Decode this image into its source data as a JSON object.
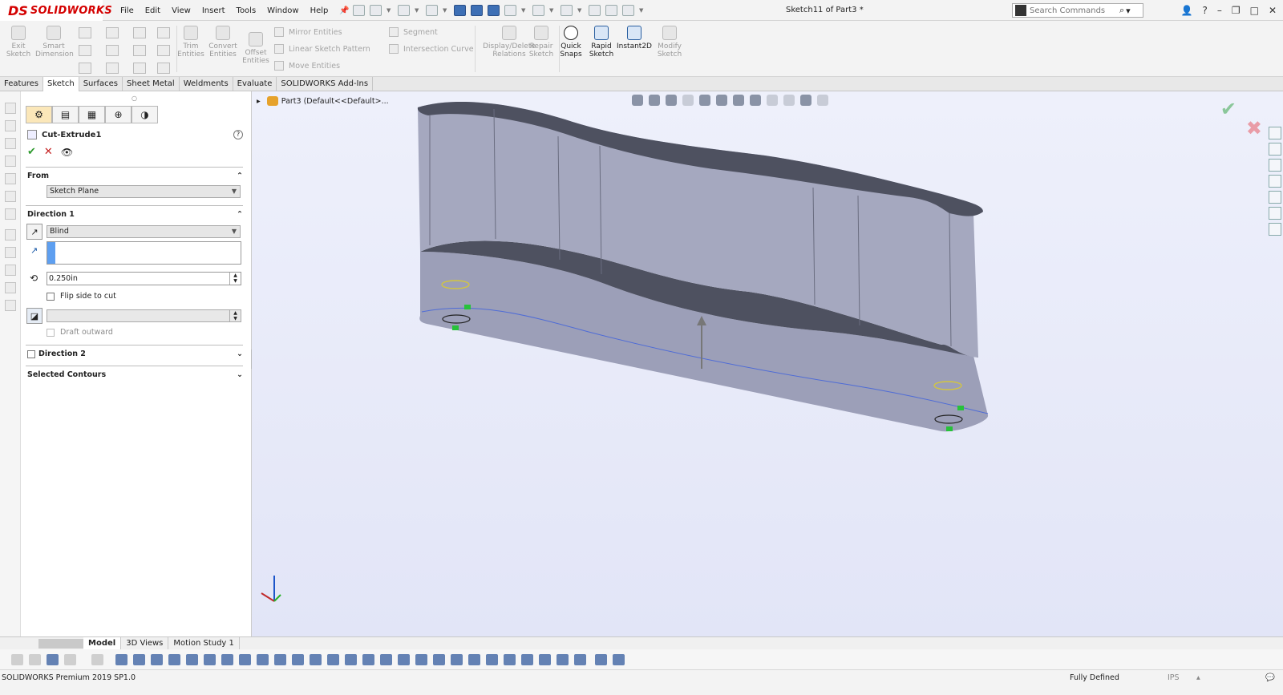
{
  "app": {
    "brand_mark": "DS",
    "brand_name": "SOLIDWORKS",
    "document_title": "Sketch11 of Part3 *",
    "pin_icon": "pushpin-icon"
  },
  "menu": [
    "File",
    "Edit",
    "View",
    "Insert",
    "Tools",
    "Window",
    "Help"
  ],
  "search": {
    "placeholder": "Search Commands"
  },
  "window_controls": {
    "help": "?"
  },
  "ribbon": {
    "exit_sketch": "Exit Sketch",
    "smart_dimension": "Smart Dimension",
    "trim_entities": "Trim Entities",
    "convert_entities": "Convert Entities",
    "offset_entities": "Offset Entities",
    "mirror_entities": "Mirror Entities",
    "linear_sketch_pattern": "Linear Sketch Pattern",
    "move_entities": "Move Entities",
    "segment": "Segment",
    "intersection_curve": "Intersection Curve",
    "display_delete_relations": "Display/Delete Relations",
    "repair_sketch": "Repair Sketch",
    "quick_snaps": "Quick Snaps",
    "rapid_sketch": "Rapid Sketch",
    "instant2d": "Instant2D",
    "modify_sketch": "Modify Sketch"
  },
  "tabs": [
    "Features",
    "Sketch",
    "Surfaces",
    "Sheet Metal",
    "Weldments",
    "Evaluate",
    "SOLIDWORKS Add-Ins"
  ],
  "property_manager": {
    "title": "Cut-Extrude1",
    "help": "?",
    "from": {
      "label": "From",
      "value": "Sketch Plane"
    },
    "direction1": {
      "label": "Direction 1",
      "end_condition": "Blind",
      "depth": "0.250in",
      "flip_side": "Flip side to cut",
      "draft_outward": "Draft outward"
    },
    "direction2": {
      "label": "Direction 2"
    },
    "selected_contours": {
      "label": "Selected Contours"
    }
  },
  "viewport": {
    "tree_root": "Part3  (Default<<Default>..."
  },
  "model_tabs": [
    "Model",
    "3D Views",
    "Motion Study 1"
  ],
  "status": {
    "product": "SOLIDWORKS Premium 2019 SP1.0",
    "sketch_state": "Fully Defined",
    "units": "IPS"
  }
}
